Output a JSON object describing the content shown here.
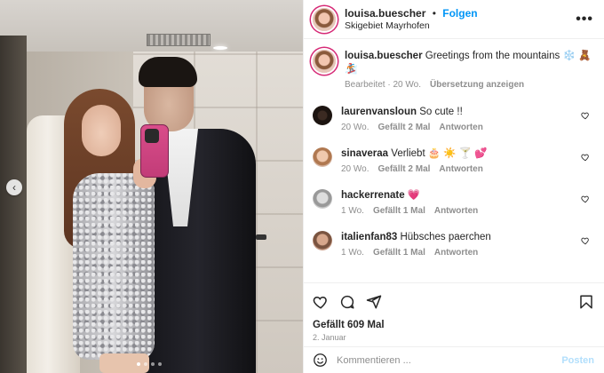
{
  "post": {
    "author": "louisa.buescher",
    "follow_label": "Folgen",
    "separator": "•",
    "location": "Skigebiet Mayrhofen",
    "more_label": "•••",
    "image_prev_label": "‹",
    "carousel_dots": 4,
    "carousel_active_index": 0
  },
  "caption": {
    "username": "louisa.buescher",
    "text": "Greetings from the mountains ❄️ 🧸 🏂",
    "meta_edited": "Bearbeitet · 20 Wo.",
    "translate_label": "Übersetzung anzeigen"
  },
  "comments": [
    {
      "username": "laurenvansloun",
      "text": "So cute !!",
      "time": "20 Wo.",
      "likes": "Gefällt 2 Mal",
      "reply": "Antworten"
    },
    {
      "username": "sinaveraa",
      "text": "Verliebt 🎂 ☀️ 🍸 💕",
      "time": "20 Wo.",
      "likes": "Gefällt 2 Mal",
      "reply": "Antworten"
    },
    {
      "username": "hackerrenate",
      "text": "💗",
      "time": "1 Wo.",
      "likes": "Gefällt 1 Mal",
      "reply": "Antworten"
    },
    {
      "username": "italienfan83",
      "text": "Hübsches paerchen",
      "time": "1 Wo.",
      "likes": "Gefällt 1 Mal",
      "reply": "Antworten"
    }
  ],
  "actions": {
    "like_icon": "heart-icon",
    "comment_icon": "comment-icon",
    "share_icon": "share-icon",
    "save_icon": "bookmark-icon"
  },
  "likes_text": "Gefällt 609 Mal",
  "date_text": "2. Januar",
  "composer": {
    "placeholder": "Kommentieren ...",
    "post_label": "Posten",
    "emoji_icon": "emoji-icon"
  },
  "colors": {
    "accent": "#0095f6",
    "post_disabled": "#b2dffc",
    "story_ring": "#d62976",
    "muted": "#8e8e8e"
  }
}
